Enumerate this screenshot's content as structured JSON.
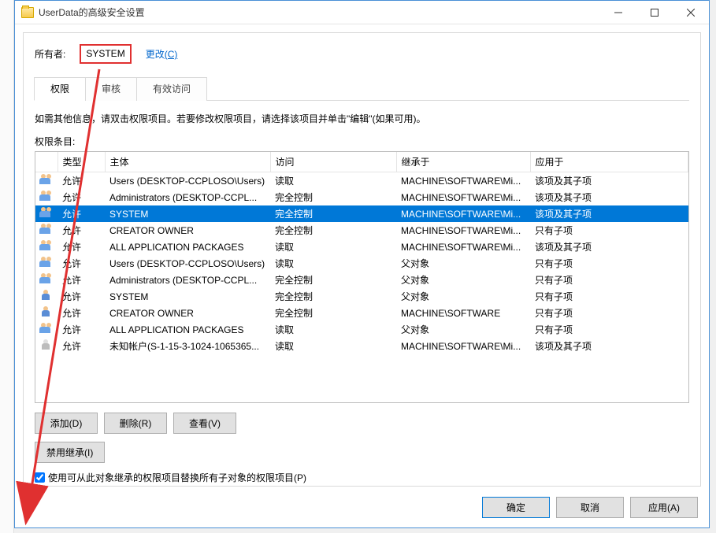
{
  "window": {
    "title": "UserData的高级安全设置"
  },
  "owner": {
    "label": "所有者:",
    "value": "SYSTEM",
    "change_text": "更改",
    "change_accel": "(C)"
  },
  "tabs": [
    {
      "label": "权限",
      "active": true
    },
    {
      "label": "审核",
      "active": false
    },
    {
      "label": "有效访问",
      "active": false
    }
  ],
  "infoline": "如需其他信息，请双击权限项目。若要修改权限项目，请选择该项目并单击\"编辑\"(如果可用)。",
  "section_label": "权限条目:",
  "columns": [
    "",
    "类型",
    "主体",
    "访问",
    "继承于",
    "应用于"
  ],
  "rows": [
    {
      "icon": "group",
      "type": "允许",
      "principal": "Users (DESKTOP-CCPLOSO\\Users)",
      "access": "读取",
      "inherited": "MACHINE\\SOFTWARE\\Mi...",
      "applies": "该项及其子项",
      "selected": false
    },
    {
      "icon": "group",
      "type": "允许",
      "principal": "Administrators (DESKTOP-CCPL...",
      "access": "完全控制",
      "inherited": "MACHINE\\SOFTWARE\\Mi...",
      "applies": "该项及其子项",
      "selected": false
    },
    {
      "icon": "group",
      "type": "允许",
      "principal": "SYSTEM",
      "access": "完全控制",
      "inherited": "MACHINE\\SOFTWARE\\Mi...",
      "applies": "该项及其子项",
      "selected": true
    },
    {
      "icon": "group",
      "type": "允许",
      "principal": "CREATOR OWNER",
      "access": "完全控制",
      "inherited": "MACHINE\\SOFTWARE\\Mi...",
      "applies": "只有子项",
      "selected": false
    },
    {
      "icon": "group",
      "type": "允许",
      "principal": "ALL APPLICATION PACKAGES",
      "access": "读取",
      "inherited": "MACHINE\\SOFTWARE\\Mi...",
      "applies": "该项及其子项",
      "selected": false
    },
    {
      "icon": "group",
      "type": "允许",
      "principal": "Users (DESKTOP-CCPLOSO\\Users)",
      "access": "读取",
      "inherited": "父对象",
      "applies": "只有子项",
      "selected": false
    },
    {
      "icon": "group",
      "type": "允许",
      "principal": "Administrators (DESKTOP-CCPL...",
      "access": "完全控制",
      "inherited": "父对象",
      "applies": "只有子项",
      "selected": false
    },
    {
      "icon": "single",
      "type": "允许",
      "principal": "SYSTEM",
      "access": "完全控制",
      "inherited": "父对象",
      "applies": "只有子项",
      "selected": false
    },
    {
      "icon": "single",
      "type": "允许",
      "principal": "CREATOR OWNER",
      "access": "完全控制",
      "inherited": "MACHINE\\SOFTWARE",
      "applies": "只有子项",
      "selected": false
    },
    {
      "icon": "group",
      "type": "允许",
      "principal": "ALL APPLICATION PACKAGES",
      "access": "读取",
      "inherited": "父对象",
      "applies": "只有子项",
      "selected": false
    },
    {
      "icon": "unknown",
      "type": "允许",
      "principal": "未知帐户(S-1-15-3-1024-1065365...",
      "access": "读取",
      "inherited": "MACHINE\\SOFTWARE\\Mi...",
      "applies": "该项及其子项",
      "selected": false
    }
  ],
  "buttons": {
    "add": "添加(D)",
    "remove": "删除(R)",
    "view": "查看(V)",
    "disable_inherit": "禁用继承(I)"
  },
  "checkbox": {
    "checked": true,
    "label": "使用可从此对象继承的权限项目替换所有子对象的权限项目(P)"
  },
  "footer": {
    "ok": "确定",
    "cancel": "取消",
    "apply": "应用(A)"
  }
}
